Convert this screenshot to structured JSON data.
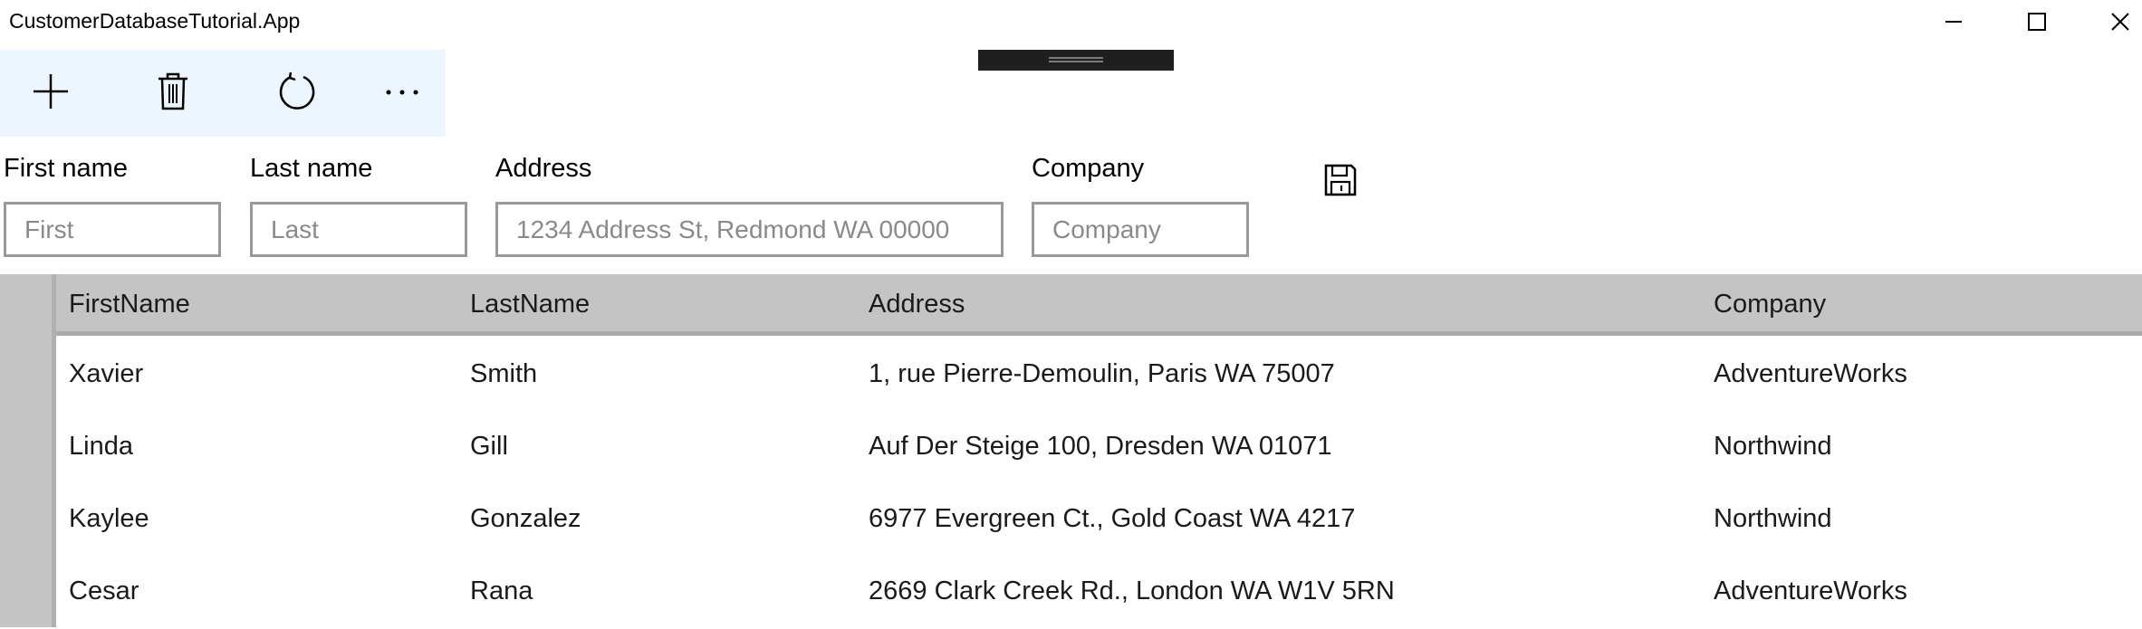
{
  "window": {
    "title": "CustomerDatabaseTutorial.App"
  },
  "titlebar_buttons": [
    {
      "name": "minimize-icon"
    },
    {
      "name": "maximize-icon"
    },
    {
      "name": "close-icon"
    }
  ],
  "commandbar": {
    "buttons": [
      {
        "icon": "add-icon"
      },
      {
        "icon": "delete-icon"
      },
      {
        "icon": "refresh-icon"
      },
      {
        "icon": "more-icon"
      }
    ]
  },
  "form": {
    "first_name": {
      "label": "First name",
      "placeholder": "First",
      "value": ""
    },
    "last_name": {
      "label": "Last name",
      "placeholder": "Last",
      "value": ""
    },
    "address": {
      "label": "Address",
      "placeholder": "1234 Address St, Redmond WA 00000",
      "value": ""
    },
    "company": {
      "label": "Company",
      "placeholder": "Company",
      "value": ""
    },
    "save_icon": "save-icon"
  },
  "grid": {
    "columns": [
      "FirstName",
      "LastName",
      "Address",
      "Company"
    ],
    "rows": [
      {
        "first": "Xavier",
        "last": "Smith",
        "address": "1, rue Pierre-Demoulin, Paris WA 75007",
        "company": "AdventureWorks"
      },
      {
        "first": "Linda",
        "last": "Gill",
        "address": "Auf Der Steige 100, Dresden WA 01071",
        "company": "Northwind"
      },
      {
        "first": "Kaylee",
        "last": "Gonzalez",
        "address": "6977 Evergreen Ct., Gold Coast WA 4217",
        "company": "Northwind"
      },
      {
        "first": "Cesar",
        "last": "Rana",
        "address": "2669 Clark Creek Rd., London WA W1V 5RN",
        "company": "AdventureWorks"
      }
    ]
  },
  "colors": {
    "commandbar_bg": "#edf5fe",
    "grid_header_bg": "#c4c4c4",
    "input_border": "#999999"
  }
}
